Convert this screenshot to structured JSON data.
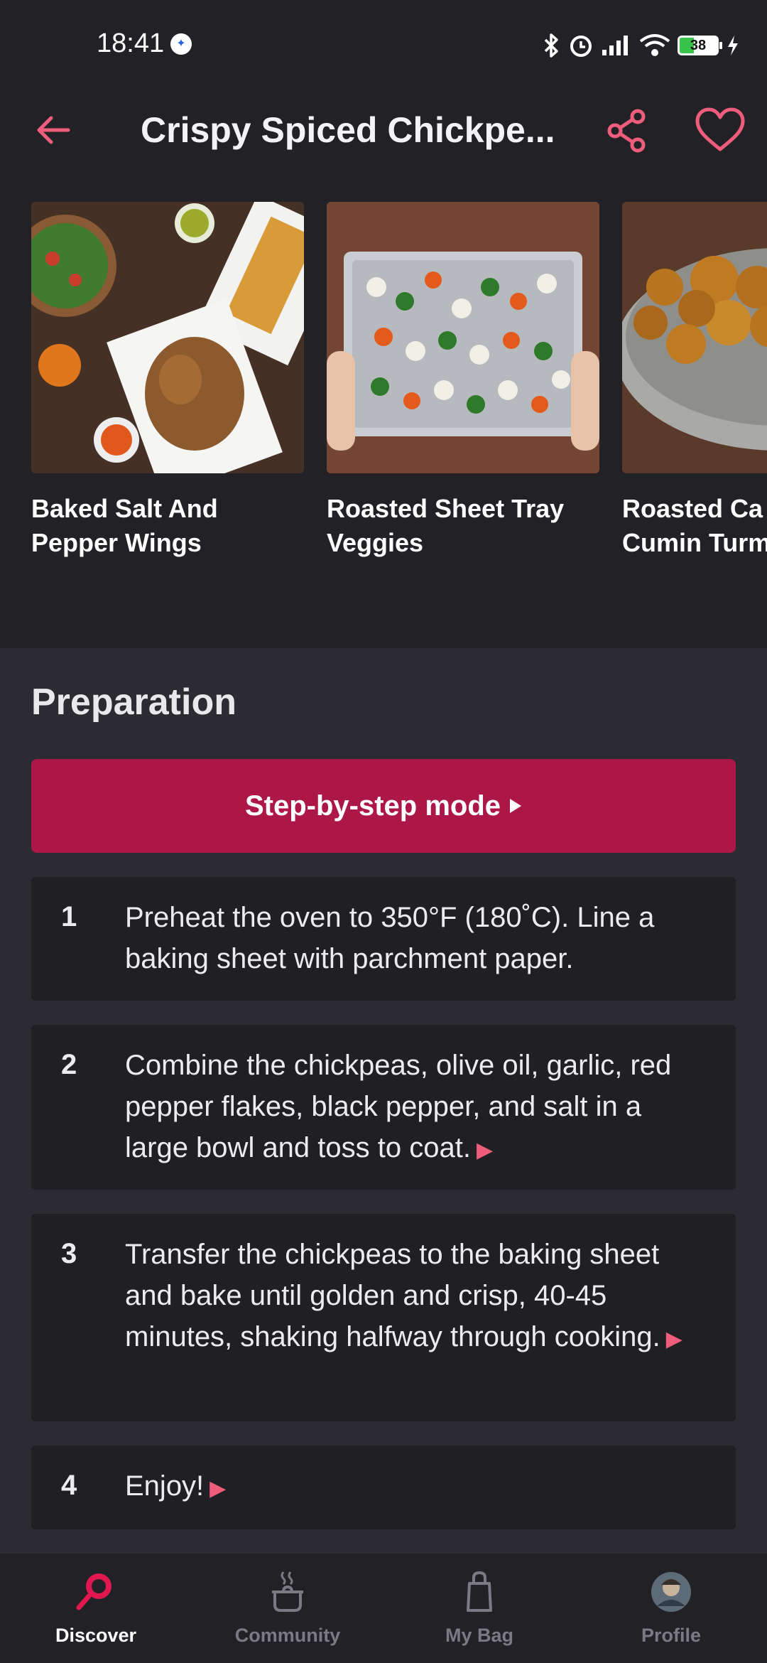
{
  "status": {
    "time": "18:41",
    "battery": "38"
  },
  "header": {
    "title": "Crispy Spiced Chickpe..."
  },
  "related": [
    {
      "title": "Baked Salt And Pepper Wings"
    },
    {
      "title": "Roasted Sheet Tray Veggies"
    },
    {
      "title": "Roasted Ca With Cumin Turmeric"
    }
  ],
  "preparation": {
    "heading": "Preparation",
    "step_mode_label": "Step-by-step mode",
    "steps": [
      {
        "num": "1",
        "text": "Preheat the oven to 350°F (180˚C). Line a baking sheet with parchment paper."
      },
      {
        "num": "2",
        "text": "Combine the chickpeas, olive oil, garlic, red pepper flakes, black pepper, and salt in a large bowl and toss to coat."
      },
      {
        "num": "3",
        "text": "Transfer the chickpeas to the baking sheet and bake until golden and crisp, 40-45 minutes, shaking halfway through cooking."
      },
      {
        "num": "4",
        "text": "Enjoy!"
      }
    ]
  },
  "tabs": [
    {
      "label": "Discover"
    },
    {
      "label": "Community"
    },
    {
      "label": "My Bag"
    },
    {
      "label": "Profile"
    }
  ],
  "colors": {
    "accent": "#ad1748",
    "icon_pink": "#ef5d7c",
    "background": "#2b2b31",
    "header": "#222226"
  }
}
